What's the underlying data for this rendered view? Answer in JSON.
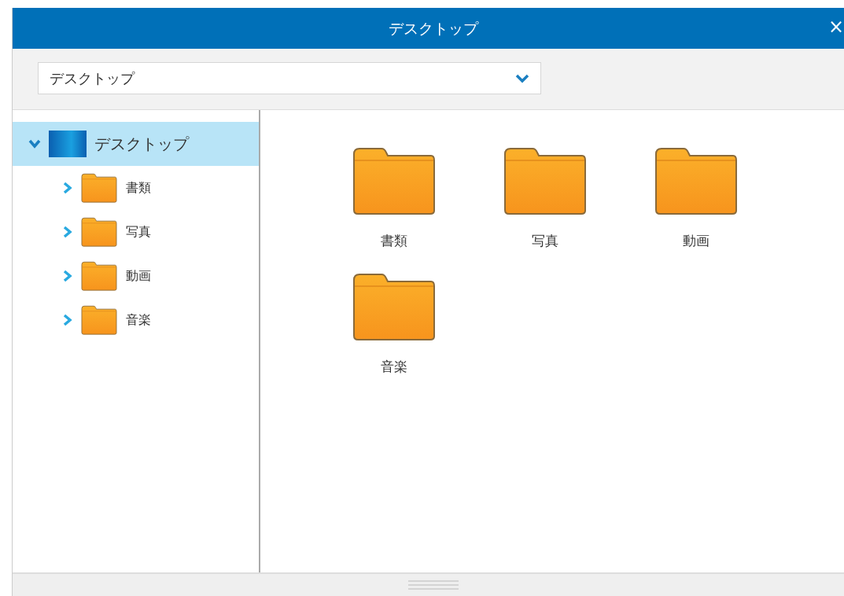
{
  "window": {
    "title": "デスクトップ",
    "close": "×"
  },
  "location": {
    "value": "デスクトップ"
  },
  "tree": [
    {
      "label": "デスクトップ",
      "kind": "desktop",
      "selected": true,
      "expanded": true,
      "children": [
        {
          "label": "書類",
          "kind": "folder",
          "selected": false,
          "expanded": false
        },
        {
          "label": "写真",
          "kind": "folder",
          "selected": false,
          "expanded": false
        },
        {
          "label": "動画",
          "kind": "folder",
          "selected": false,
          "expanded": false
        },
        {
          "label": "音楽",
          "kind": "folder",
          "selected": false,
          "expanded": false
        }
      ]
    }
  ],
  "items": [
    {
      "label": "書類",
      "kind": "folder"
    },
    {
      "label": "写真",
      "kind": "folder"
    },
    {
      "label": "動画",
      "kind": "folder"
    },
    {
      "label": "音楽",
      "kind": "folder"
    }
  ]
}
